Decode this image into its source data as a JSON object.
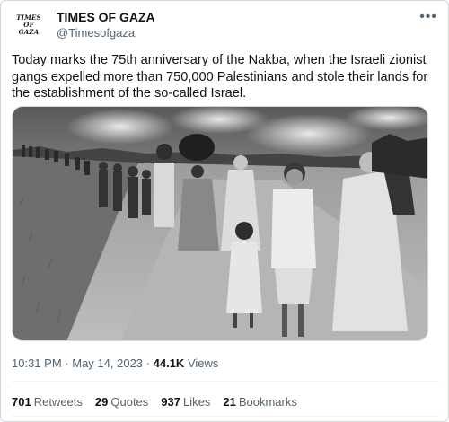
{
  "account": {
    "logo_text": [
      "TIMES",
      "OF",
      "GAZA"
    ],
    "name": "TIMES OF GAZA",
    "handle": "@Timesofgaza"
  },
  "tweet": {
    "text": "Today marks the 75th anniversary of the Nakba, when the Israeli zionist gangs expelled more than 750,000 Palestinians and stole their lands for the establishment of the so-called Israel."
  },
  "meta": {
    "time": "10:31 PM",
    "separator": "·",
    "date": "May 14, 2023",
    "views_count": "44.1K",
    "views_label": "Views"
  },
  "stats": {
    "retweets_count": "701",
    "retweets_label": "Retweets",
    "quotes_count": "29",
    "quotes_label": "Quotes",
    "likes_count": "937",
    "likes_label": "Likes",
    "bookmarks_count": "21",
    "bookmarks_label": "Bookmarks"
  },
  "icons": {
    "more": "more-horizontal-icon"
  }
}
